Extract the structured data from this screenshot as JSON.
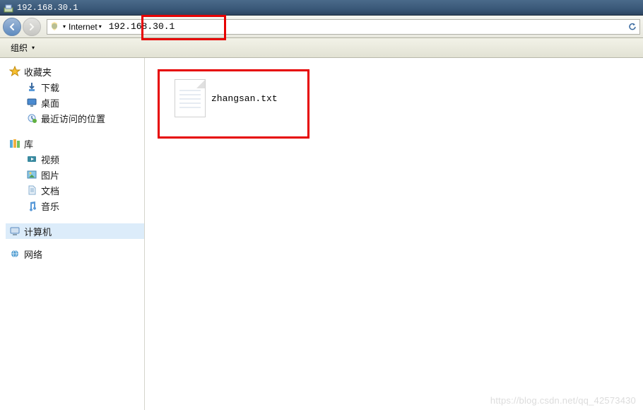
{
  "title": "192.168.30.1",
  "address_bar": {
    "zone": "Internet",
    "path": "192.168.30.1"
  },
  "toolbar": {
    "organize": "组织"
  },
  "sidebar": {
    "favorites": {
      "label": "收藏夹"
    },
    "favorites_children": [
      {
        "label": "下载"
      },
      {
        "label": "桌面"
      },
      {
        "label": "最近访问的位置"
      }
    ],
    "libraries": {
      "label": "库"
    },
    "libraries_children": [
      {
        "label": "视频"
      },
      {
        "label": "图片"
      },
      {
        "label": "文档"
      },
      {
        "label": "音乐"
      }
    ],
    "computer": {
      "label": "计算机"
    },
    "network": {
      "label": "网络"
    }
  },
  "content": {
    "files": [
      {
        "name": "zhangsan.txt"
      }
    ]
  },
  "watermark": "https://blog.csdn.net/qq_42573430"
}
